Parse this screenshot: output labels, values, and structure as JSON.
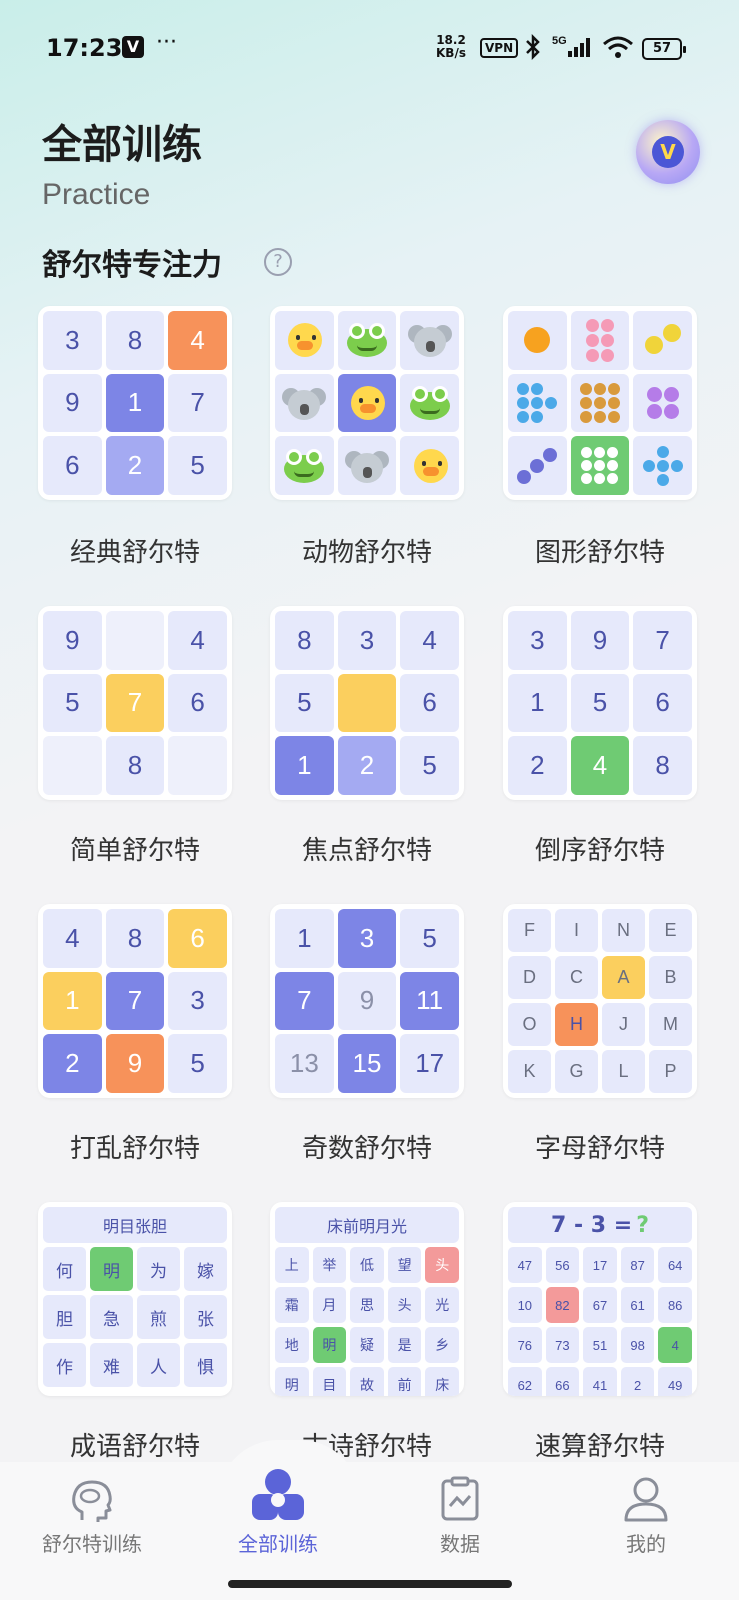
{
  "status_bar": {
    "time": "17:23",
    "app_badge": "V",
    "dots": "···",
    "speed": "18.2",
    "speed_unit": "KB/s",
    "vpn": "VPN",
    "network": "5G",
    "battery": "57"
  },
  "header": {
    "title": "全部训练",
    "subtitle": "Practice",
    "vip_badge": "V"
  },
  "section": {
    "title": "舒尔特专注力",
    "help": "?"
  },
  "cards": {
    "classic": {
      "label": "经典舒尔特",
      "cells": [
        "3",
        "8",
        "4",
        "9",
        "1",
        "7",
        "6",
        "2",
        "5"
      ]
    },
    "animal": {
      "label": "动物舒尔特"
    },
    "shape": {
      "label": "图形舒尔特"
    },
    "simple": {
      "label": "简单舒尔特",
      "cells": [
        "9",
        "",
        "4",
        "5",
        "7",
        "6",
        "",
        "8",
        ""
      ]
    },
    "focus": {
      "label": "焦点舒尔特",
      "cells": [
        "8",
        "3",
        "4",
        "5",
        "",
        "6",
        "1",
        "2",
        "5"
      ]
    },
    "reverse": {
      "label": "倒序舒尔特",
      "cells": [
        "3",
        "9",
        "7",
        "1",
        "5",
        "6",
        "2",
        "4",
        "8"
      ]
    },
    "shuffle": {
      "label": "打乱舒尔特",
      "cells": [
        "4",
        "8",
        "6",
        "1",
        "7",
        "3",
        "2",
        "9",
        "5"
      ]
    },
    "odd": {
      "label": "奇数舒尔特",
      "cells": [
        "1",
        "3",
        "5",
        "7",
        "9",
        "11",
        "13",
        "15",
        "17"
      ]
    },
    "letter": {
      "label": "字母舒尔特",
      "cells": [
        "F",
        "I",
        "N",
        "E",
        "D",
        "C",
        "A",
        "B",
        "O",
        "H",
        "J",
        "M",
        "K",
        "G",
        "L",
        "P"
      ]
    },
    "idiom": {
      "label": "成语舒尔特",
      "header": "明目张胆",
      "cells": [
        "何",
        "明",
        "为",
        "嫁",
        "胆",
        "急",
        "煎",
        "张",
        "作",
        "难",
        "人",
        "惧"
      ]
    },
    "poem": {
      "label": "古诗舒尔特",
      "header": "床前明月光",
      "cells": [
        "上",
        "举",
        "低",
        "望",
        "头",
        "霜",
        "月",
        "思",
        "头",
        "光",
        "地",
        "明",
        "疑",
        "是",
        "乡",
        "明",
        "目",
        "故",
        "前",
        "床"
      ]
    },
    "math": {
      "label": "速算舒尔特",
      "equation": "7 - 3 =",
      "question": "?",
      "cells": [
        "47",
        "56",
        "17",
        "87",
        "64",
        "10",
        "82",
        "67",
        "61",
        "86",
        "76",
        "73",
        "51",
        "98",
        "4",
        "62",
        "66",
        "41",
        "2",
        "49"
      ]
    }
  },
  "tabs": [
    {
      "label": "舒尔特训练"
    },
    {
      "label": "全部训练"
    },
    {
      "label": "数据"
    },
    {
      "label": "我的"
    }
  ],
  "colors": {
    "accent": "#5b64d8",
    "cell_bg": "#e6e9fb",
    "blue": "#7d85e6",
    "orange": "#f7925a",
    "yellow": "#fbcf5e",
    "green": "#6fcb73"
  }
}
